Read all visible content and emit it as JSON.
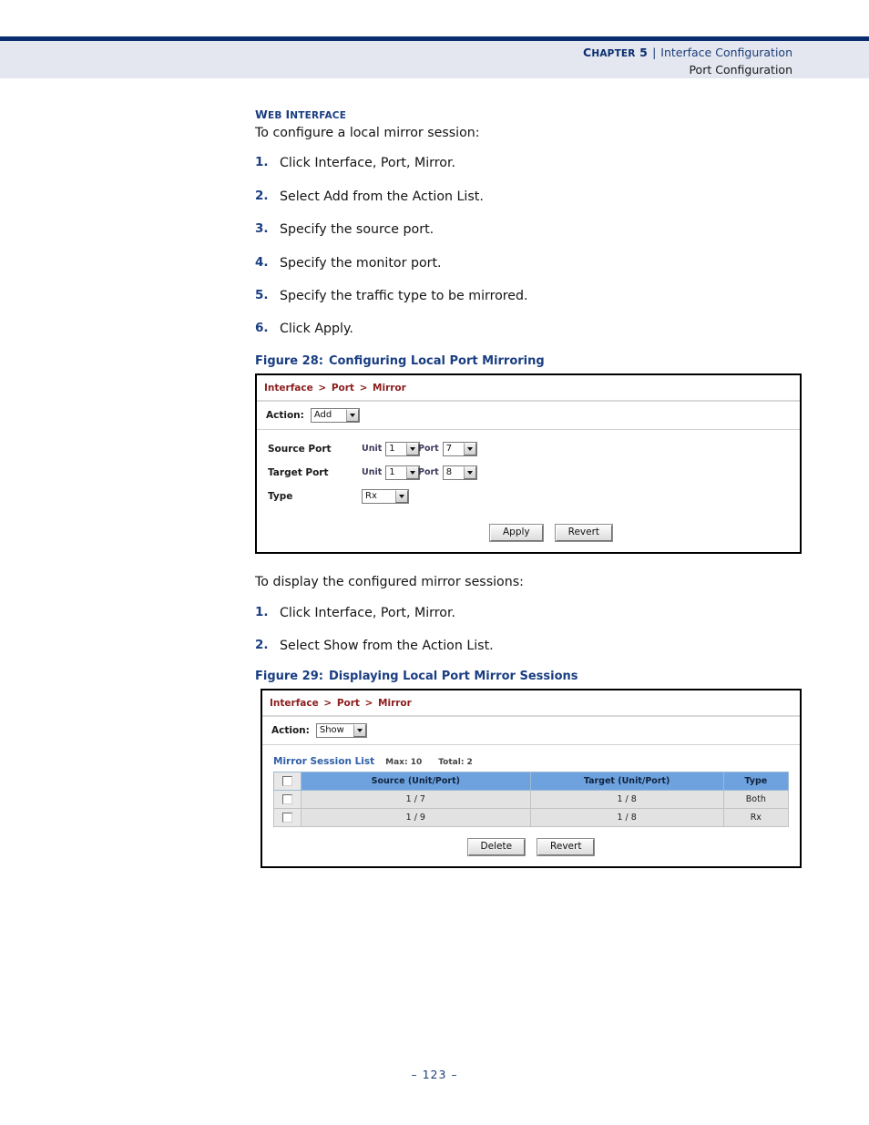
{
  "header": {
    "chapter_label": "Chapter 5",
    "chapter_first": "C",
    "chapter_rest": "HAPTER",
    "chapter_num": "5",
    "separator": "|",
    "title": "Interface Configuration",
    "subtitle": "Port Configuration"
  },
  "section": {
    "heading_first": "W",
    "heading_rest1": "EB ",
    "heading_first2": "I",
    "heading_rest2": "NTERFACE",
    "heading_full": "WEB INTERFACE",
    "intro": "To configure a local mirror session:"
  },
  "steps_configure": [
    {
      "num": "1.",
      "text": "Click Interface, Port, Mirror."
    },
    {
      "num": "2.",
      "text": "Select Add from the Action List."
    },
    {
      "num": "3.",
      "text": "Specify the source port."
    },
    {
      "num": "4.",
      "text": "Specify the monitor port."
    },
    {
      "num": "5.",
      "text": "Specify the traffic type to be mirrored."
    },
    {
      "num": "6.",
      "text": "Click Apply."
    }
  ],
  "figure28": {
    "caption_label": "Figure 28:",
    "caption_title": "Configuring Local Port Mirroring",
    "breadcrumb": "Interface > Port > Mirror",
    "breadcrumb_parts": [
      "Interface",
      "Port",
      "Mirror"
    ],
    "action_label": "Action:",
    "action_value": "Add",
    "rows": [
      {
        "label": "Source Port",
        "unit_label": "Unit",
        "unit_value": "1",
        "port_label": "Port",
        "port_value": "7"
      },
      {
        "label": "Target Port",
        "unit_label": "Unit",
        "unit_value": "1",
        "port_label": "Port",
        "port_value": "8"
      }
    ],
    "type_label": "Type",
    "type_value": "Rx",
    "apply_button": "Apply",
    "revert_button": "Revert"
  },
  "middle": {
    "intro": "To display the configured mirror sessions:"
  },
  "steps_display": [
    {
      "num": "1.",
      "text": "Click Interface, Port, Mirror."
    },
    {
      "num": "2.",
      "text": "Select Show from the Action List."
    }
  ],
  "figure29": {
    "caption_label": "Figure 29:",
    "caption_title": "Displaying Local Port Mirror Sessions",
    "breadcrumb": "Interface > Port > Mirror",
    "breadcrumb_parts": [
      "Interface",
      "Port",
      "Mirror"
    ],
    "action_label": "Action:",
    "action_value": "Show",
    "list_title": "Mirror Session List",
    "max_label": "Max: 10",
    "total_label": "Total: 2",
    "table": {
      "headers": [
        "",
        "Source (Unit/Port)",
        "Target (Unit/Port)",
        "Type"
      ],
      "rows": [
        {
          "source": "1 / 7",
          "target": "1 / 8",
          "type": "Both"
        },
        {
          "source": "1 / 9",
          "target": "1 / 8",
          "type": "Rx"
        }
      ]
    },
    "delete_button": "Delete",
    "revert_button": "Revert"
  },
  "footer": {
    "page_number": "–  123  –"
  },
  "colors": {
    "navy_rule": "#0a2d6e",
    "header_band": "#e4e7f0",
    "heading_blue": "#1a3e82",
    "breadcrumb_red": "#8c1d1d",
    "table_header_blue": "#6ea2de",
    "list_title_blue": "#2f5fa8"
  }
}
